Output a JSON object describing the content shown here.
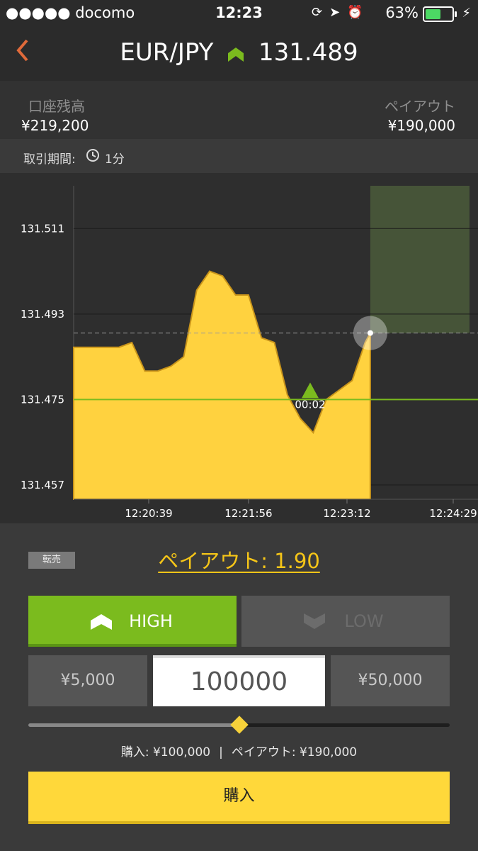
{
  "status_bar": {
    "carrier": "●●●●● docomo",
    "time": "12:23",
    "battery_text": "63%",
    "battery_level_percent": 63,
    "battery_color": "#4cd964"
  },
  "header": {
    "back_icon": "chevron-left-icon",
    "pair": "EUR/JPY",
    "trend_icon": "up-chevron-icon",
    "price": "131.489",
    "accent": "#7bbb1e",
    "back_color": "#e06a3a"
  },
  "account": {
    "balance_label": "口座残高",
    "balance_value": "¥219,200",
    "payout_label": "ペイアウト",
    "payout_value": "¥190,000"
  },
  "period": {
    "label": "取引期間:",
    "clock_icon": "clock-icon",
    "value": "1分"
  },
  "chart_data": {
    "type": "area",
    "y_ticks": [
      "131.511",
      "131.493",
      "131.475",
      "131.457"
    ],
    "x_ticks": [
      "12:20:39",
      "12:21:56",
      "12:23:12",
      "12:24:29"
    ],
    "ylim": [
      131.454,
      131.52
    ],
    "x": [
      "12:20:06",
      "12:20:16",
      "12:20:26",
      "12:20:36",
      "12:20:46",
      "12:20:56",
      "12:21:06",
      "12:21:16",
      "12:21:26",
      "12:21:36",
      "12:21:46",
      "12:21:56",
      "12:22:06",
      "12:22:16",
      "12:22:26",
      "12:22:36",
      "12:22:46",
      "12:22:56",
      "12:23:06",
      "12:23:16",
      "12:23:26",
      "12:23:30"
    ],
    "values": [
      131.486,
      131.486,
      131.487,
      131.481,
      131.481,
      131.482,
      131.484,
      131.498,
      131.502,
      131.501,
      131.497,
      131.497,
      131.488,
      131.487,
      131.476,
      131.471,
      131.468,
      131.475,
      131.477,
      131.479,
      131.487,
      131.489
    ],
    "current_price": "131.489",
    "entry_price": 131.475,
    "entry_label": "00:02",
    "fill_color": "#ffd23f",
    "entry_color": "#7bbb1e"
  },
  "panel": {
    "resell_label": "転売",
    "payout_rate": "ペイアウト: 1.90",
    "high_label": "HIGH",
    "low_label": "LOW",
    "amount_preset_1": "¥5,000",
    "amount_value": "100000",
    "amount_preset_2": "¥50,000",
    "slider_fraction": 0.5,
    "summary_buy": "購入: ¥100,000",
    "summary_sep": "|",
    "summary_payout": "ペイアウト: ¥190,000",
    "buy_label": "購入",
    "high_icon": "up-chevron-icon",
    "low_icon": "down-chevron-icon"
  }
}
